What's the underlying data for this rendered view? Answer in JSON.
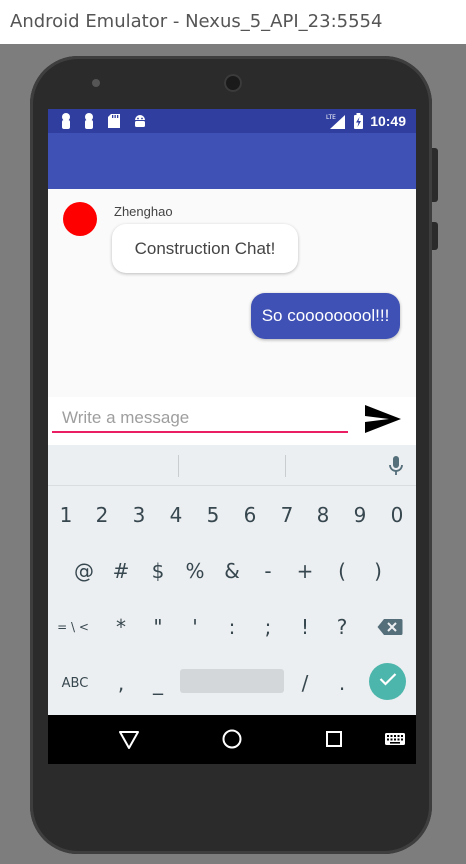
{
  "window": {
    "title": "Android Emulator - Nexus_5_API_23:5554"
  },
  "status_bar": {
    "time": "10:49",
    "network": "LTE",
    "notification_icons": [
      "lock-icon",
      "lock-icon",
      "sd-card-icon",
      "android-icon"
    ]
  },
  "chat": {
    "messages": [
      {
        "sender": "Zhenghao",
        "text": "Construction Chat!",
        "direction": "incoming",
        "avatar_color": "#ff0000"
      },
      {
        "text": "So cooooooool!!!",
        "direction": "outgoing"
      }
    ]
  },
  "composer": {
    "placeholder": "Write a message",
    "value": ""
  },
  "keyboard": {
    "row1": [
      "1",
      "2",
      "3",
      "4",
      "5",
      "6",
      "7",
      "8",
      "9",
      "0"
    ],
    "row2": [
      "@",
      "#",
      "$",
      "%",
      "&",
      "-",
      "+",
      "(",
      ")"
    ],
    "row3": [
      "= \\ <",
      "*",
      "\"",
      "'",
      ":",
      ";",
      "!",
      "?"
    ],
    "row4": [
      "ABC",
      ",",
      "_",
      "/",
      "."
    ]
  },
  "colors": {
    "primary": "#3f51b5",
    "primary_dark": "#303f9f",
    "accent": "#e91e63",
    "done_key": "#4db6ac"
  }
}
